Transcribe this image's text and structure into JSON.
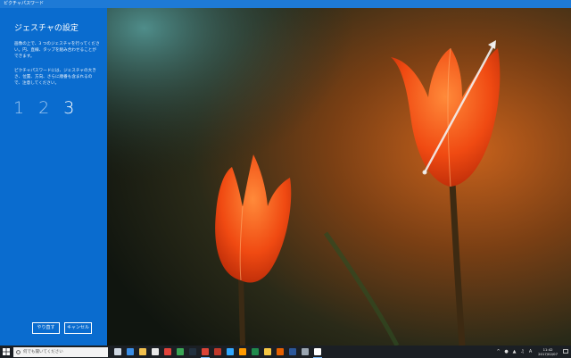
{
  "window": {
    "title": "ピクチャパスワード"
  },
  "panel": {
    "title": "ジェスチャの設定",
    "instructions": "画像の上で、3 つのジェスチャを行ってください。円、直線、タップを組み合わせることができます。",
    "note": "ピクチャパスワードには、ジェスチャの大きさ、位置、方向、さらに順番も含まれるので、注意してください。",
    "steps": [
      "1",
      "2",
      "3"
    ],
    "active_step": "3",
    "redo_label": "やり直す",
    "cancel_label": "キャンセル"
  },
  "taskbar": {
    "search_placeholder": "何でも聞いてください",
    "apps": [
      {
        "name": "task-view-icon",
        "color": "#cfd8e3",
        "running": false
      },
      {
        "name": "edge-icon",
        "color": "#3a8ee6",
        "running": false
      },
      {
        "name": "file-explorer-icon",
        "color": "#f2c14e",
        "running": false
      },
      {
        "name": "store-icon",
        "color": "#e8e8e8",
        "running": false
      },
      {
        "name": "media-icon",
        "color": "#e2433b",
        "running": false
      },
      {
        "name": "app-green-icon",
        "color": "#3aa655",
        "running": false
      },
      {
        "name": "terminal-icon",
        "color": "#22313f",
        "running": false
      },
      {
        "name": "chrome-icon",
        "color": "#db4437",
        "running": true
      },
      {
        "name": "app-red-icon",
        "color": "#c0392b",
        "running": false
      },
      {
        "name": "photoshop-icon",
        "color": "#31a8ff",
        "running": false
      },
      {
        "name": "illustrator-icon",
        "color": "#ff9a00",
        "running": false
      },
      {
        "name": "excel-icon",
        "color": "#1f8a4c",
        "running": false
      },
      {
        "name": "app-yellow-icon",
        "color": "#f6c744",
        "running": false
      },
      {
        "name": "firefox-icon",
        "color": "#e66000",
        "running": false
      },
      {
        "name": "word-icon",
        "color": "#2b579a",
        "running": false
      },
      {
        "name": "gear-icon",
        "color": "#9aa5b1",
        "running": false
      },
      {
        "name": "settings-icon",
        "color": "#ffffff",
        "running": true
      }
    ],
    "time": "11:42",
    "date": "2017/02/07"
  },
  "colors": {
    "panel_bg": "#0a6ccf",
    "titlebar_bg": "#1e7ad6",
    "taskbar_bg": "#1b1f24"
  }
}
